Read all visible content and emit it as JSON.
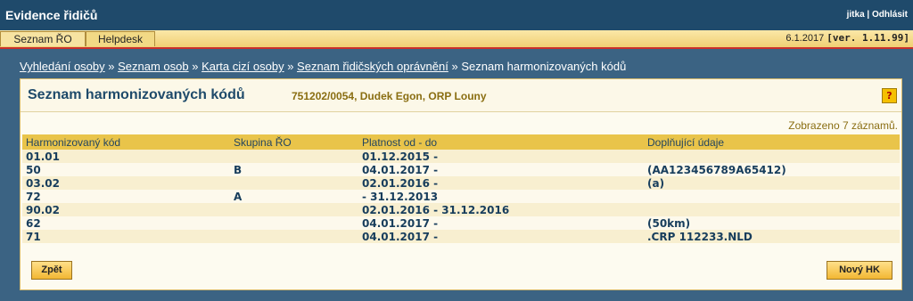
{
  "app": {
    "title": "Evidence řidičů",
    "user": "jitka | Odhlásit"
  },
  "menu": {
    "tabs": [
      "Seznam ŘO",
      "Helpdesk"
    ],
    "date": "6.1.2017",
    "version": "[ver. 1.11.99]"
  },
  "breadcrumb": [
    "Vyhledání osoby",
    "Seznam osob",
    "Karta cizí osoby",
    "Seznam řidičských oprávnění",
    "Seznam harmonizovaných kódů"
  ],
  "panel": {
    "title": "Seznam harmonizovaných kódů",
    "person": "751202/0054, Dudek Egon, ORP Louny",
    "help": "?",
    "count": "Zobrazeno 7 záznamů.",
    "columns": [
      "Harmonizovaný kód",
      "Skupina ŘO",
      "Platnost od - do",
      "Doplňující údaje"
    ],
    "rows": [
      [
        "01.01",
        "",
        "01.12.2015 -",
        ""
      ],
      [
        "50",
        "B",
        "04.01.2017 -",
        "(AA123456789A65412)"
      ],
      [
        "03.02",
        "",
        "02.01.2016 -",
        "(a)"
      ],
      [
        "72",
        "A",
        "- 31.12.2013",
        ""
      ],
      [
        "90.02",
        "",
        "02.01.2016 - 31.12.2016",
        ""
      ],
      [
        "62",
        "",
        "04.01.2017 -",
        "(50km)"
      ],
      [
        "71",
        "",
        "04.01.2017 -",
        ".CRP 112233.NLD"
      ]
    ],
    "back_label": "Zpět",
    "new_label": "Nový HK"
  }
}
